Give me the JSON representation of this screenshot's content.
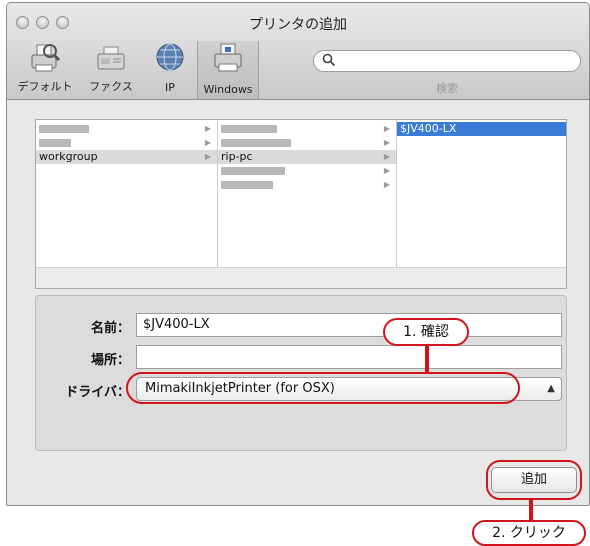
{
  "window": {
    "title": "プリンタの追加"
  },
  "toolbar": {
    "items": [
      {
        "label": "デフォルト",
        "icon": "default-printer-icon"
      },
      {
        "label": "ファクス",
        "icon": "fax-icon"
      },
      {
        "label": "IP",
        "icon": "ip-globe-icon"
      },
      {
        "label": "Windows",
        "icon": "windows-printer-icon",
        "selected": true
      }
    ],
    "search_label": "検索"
  },
  "browser": {
    "col1": [
      {
        "label": "workgroup",
        "selected": true
      }
    ],
    "col2": [
      {
        "label": "rip-pc",
        "selected": true
      }
    ],
    "col3": [
      {
        "label": "$JV400-LX",
        "active": true
      }
    ]
  },
  "form": {
    "name_label": "名前：",
    "name_value": "$JV400-LX",
    "location_label": "場所：",
    "location_value": "",
    "driver_label": "ドライバ：",
    "driver_value": "MimakiInkjetPrinter (for OSX)"
  },
  "add_button": "追加",
  "annotations": {
    "step1": "1. 確認",
    "step2": "2. クリック",
    "color": "#d2141c"
  }
}
